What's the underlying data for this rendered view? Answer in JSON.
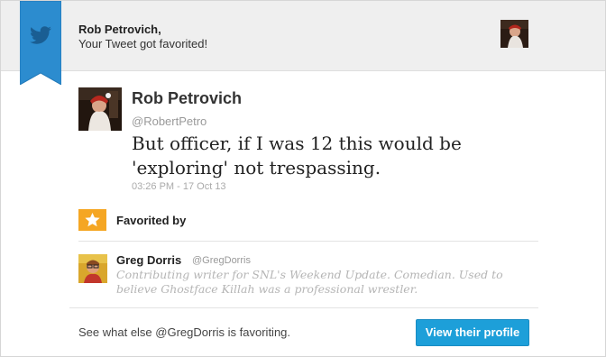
{
  "notification": {
    "user_name": "Rob Petrovich,",
    "message": "Your Tweet got favorited!"
  },
  "tweet": {
    "author_name": "Rob Petrovich",
    "author_handle": "@RobertPetro",
    "text": "But officer, if I was 12 this would be 'exploring' not trespassing.",
    "timestamp": "03:26 PM - 17 Oct 13"
  },
  "favorited_section": {
    "label": "Favorited by"
  },
  "favoriter": {
    "name": "Greg Dorris",
    "handle": "@GregDorris",
    "bio": "Contributing writer for SNL's Weekend Update. Comedian. Used to believe Ghostface Killah was a professional wrestler."
  },
  "footer": {
    "text": "See what else @GregDorris is favoriting.",
    "button_label": "View their profile"
  },
  "colors": {
    "brand_blue": "#1d9fd9",
    "favorite_orange": "#f5a623"
  },
  "icons": [
    "twitter-bird-icon",
    "star-icon"
  ]
}
